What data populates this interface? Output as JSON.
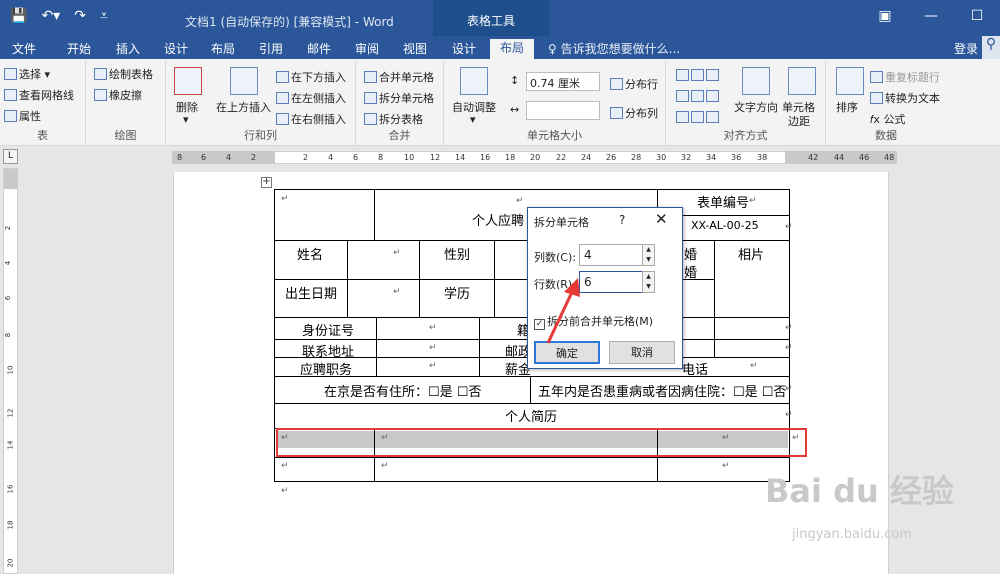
{
  "app": {
    "doc_title": "文档1 (自动保存的) [兼容模式] - Word",
    "context_title": "表格工具"
  },
  "tabs": [
    "文件",
    "开始",
    "插入",
    "设计",
    "布局",
    "引用",
    "邮件",
    "审阅",
    "视图",
    "设计",
    "布局"
  ],
  "tell_me": "告诉我您想要做什么...",
  "login": "登录",
  "ribbon": {
    "table": {
      "label": "表",
      "select": "选择",
      "gridlines": "查看网格线",
      "properties": "属性"
    },
    "draw": {
      "label": "绘图",
      "draw_table": "绘制表格",
      "eraser": "橡皮擦"
    },
    "rows_cols": {
      "label": "行和列",
      "delete": "删除",
      "insert_above": "在上方插入",
      "insert_below": "在下方插入",
      "insert_left": "在左侧插入",
      "insert_right": "在右侧插入"
    },
    "merge": {
      "label": "合并",
      "merge_cells": "合并单元格",
      "split_cells": "拆分单元格",
      "split_table": "拆分表格"
    },
    "cell_size": {
      "label": "单元格大小",
      "autofit": "自动调整",
      "height": "0.74 厘米",
      "dist_rows": "分布行",
      "dist_cols": "分布列"
    },
    "alignment": {
      "label": "对齐方式",
      "text_dir": "文字方向",
      "margins_1": "单元格",
      "margins_2": "边距"
    },
    "data": {
      "label": "数据",
      "sort": "排序",
      "repeat_header": "重复标题行",
      "to_text": "转换为文本",
      "formula": "公式"
    }
  },
  "ruler": {
    "h_numbers": [
      "8",
      "6",
      "4",
      "2",
      "2",
      "4",
      "6",
      "8",
      "10",
      "12",
      "14",
      "16",
      "18",
      "20",
      "22",
      "24",
      "26",
      "28",
      "30",
      "32",
      "34",
      "36",
      "38",
      "42",
      "44",
      "46",
      "48"
    ],
    "v_numbers": [
      "2",
      "4",
      "6",
      "8",
      "10",
      "12",
      "14",
      "16",
      "18",
      "20"
    ]
  },
  "table": {
    "form_title": "个人应聘",
    "form_no_label": "表单编号",
    "form_no": "XX-AL-00-25",
    "name": "姓名",
    "gender": "性别",
    "marital_1": "婚",
    "marital_2": "婚",
    "photo": "相片",
    "birth": "出生日期",
    "education": "学历",
    "id_no": "身份证号",
    "native": "籍",
    "address": "联系地址",
    "postcode": "邮政",
    "position": "应聘职务",
    "salary": "薪金",
    "phone": "电话",
    "housing": "在京是否有住所：☐是 ☐否",
    "illness": "五年内是否患重病或者因病住院：☐是 ☐否",
    "resume": "个人简历",
    "para_mark": "↵"
  },
  "dialog": {
    "title": "拆分单元格",
    "help": "?",
    "close": "✕",
    "cols_label": "列数(C):",
    "cols_value": "4",
    "rows_label": "行数(R):",
    "rows_value": "6",
    "merge_before_label": "拆分前合并单元格(M)",
    "merge_before_checked": true,
    "ok": "确定",
    "cancel": "取消"
  },
  "watermark": {
    "main": "Bai du 经验",
    "sub": "jingyan.baidu.com"
  },
  "colors": {
    "word_blue": "#2b579a",
    "highlight_red": "#e53935"
  }
}
